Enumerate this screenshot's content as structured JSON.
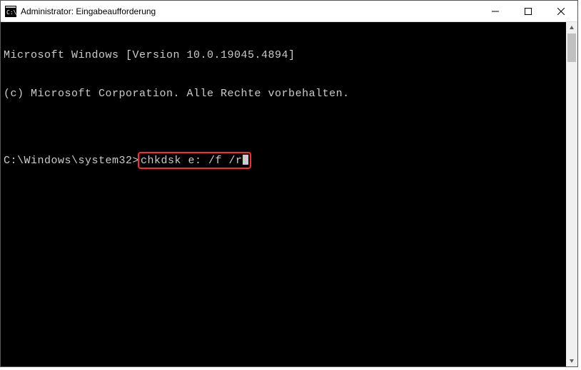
{
  "window": {
    "title": "Administrator: Eingabeaufforderung"
  },
  "terminal": {
    "line1": "Microsoft Windows [Version 10.0.19045.4894]",
    "line2": "(c) Microsoft Corporation. Alle Rechte vorbehalten.",
    "blank": "",
    "prompt": "C:\\Windows\\system32>",
    "command": "chkdsk e: /f /r"
  }
}
